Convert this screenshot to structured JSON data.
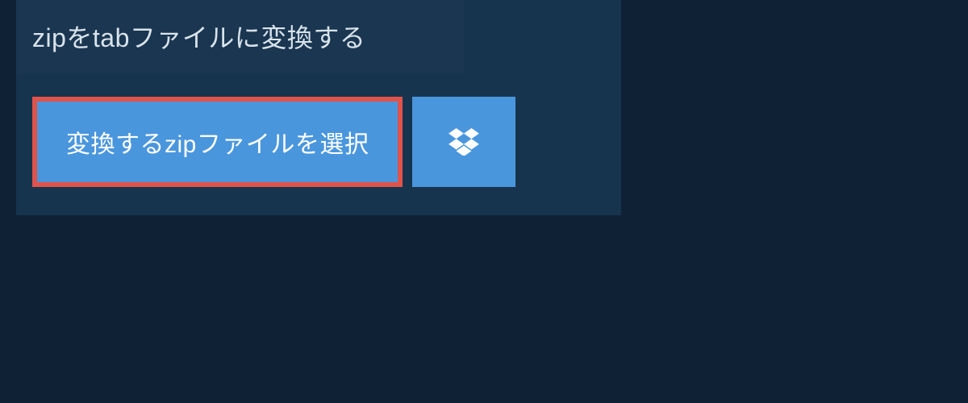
{
  "header": {
    "title": "zipをtabファイルに変換する"
  },
  "buttons": {
    "select_file_label": "変換するzipファイルを選択"
  },
  "colors": {
    "page_bg": "#0f2235",
    "panel_bg": "#17344e",
    "header_bg": "#1a3651",
    "button_bg": "#4a96dd",
    "highlight_border": "#e0534b",
    "text_light": "#d9e3eb",
    "text_white": "#ffffff"
  }
}
